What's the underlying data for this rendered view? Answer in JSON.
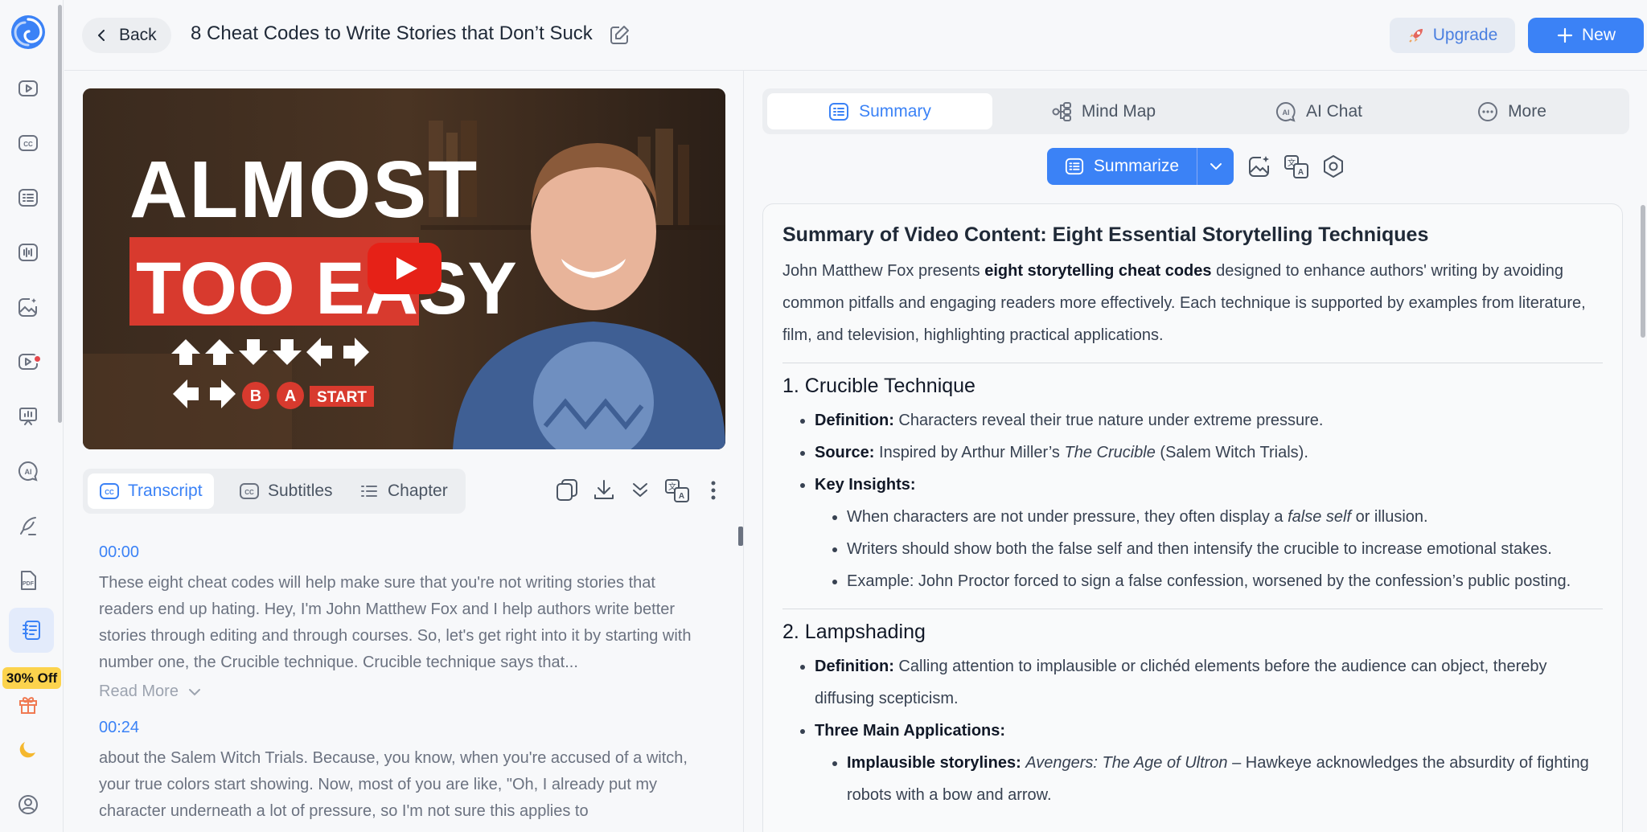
{
  "header": {
    "back_label": "Back",
    "title": "8 Cheat Codes to Write Stories that Don’t Suck",
    "upgrade_label": "Upgrade",
    "new_label": "New"
  },
  "sidebar": {
    "promo_badge": "30% Off",
    "items": [
      {
        "icon": "video-icon"
      },
      {
        "icon": "captions-icon"
      },
      {
        "icon": "list-icon"
      },
      {
        "icon": "audio-icon"
      },
      {
        "icon": "image-edit-icon"
      },
      {
        "icon": "video-ai-icon"
      },
      {
        "icon": "presentation-icon"
      },
      {
        "icon": "ai-chat-icon"
      },
      {
        "icon": "write-icon"
      },
      {
        "icon": "pdf-icon"
      },
      {
        "icon": "notes-icon"
      },
      {
        "icon": "gift-icon"
      },
      {
        "icon": "moon-icon"
      },
      {
        "icon": "account-icon"
      }
    ]
  },
  "video": {
    "thumb_line1": "ALMOST",
    "thumb_line2": "TOO EASY",
    "thumb_start": "START",
    "thumb_b": "B",
    "thumb_a": "A"
  },
  "left_tabs": {
    "transcript": "Transcript",
    "subtitles": "Subtitles",
    "chapter": "Chapter"
  },
  "transcript": [
    {
      "time": "00:00",
      "text": "These eight cheat codes will help make sure that you're not writing stories that readers end up hating. Hey, I'm John Matthew Fox and I help authors write better stories through editing and through courses. So, let's get right into it by starting with number one, the Crucible technique. Crucible technique says that...",
      "read_more": "Read More"
    },
    {
      "time": "00:24",
      "text": "about the Salem Witch Trials. Because, you know, when you're accused of a witch, your true colors start showing. Now, most of you are like, \"Oh, I already put my character underneath a lot of pressure, so I'm not sure this applies to"
    }
  ],
  "right_tabs": {
    "summary": "Summary",
    "mindmap": "Mind Map",
    "aichat": "AI Chat",
    "more": "More"
  },
  "summarize_label": "Summarize",
  "summary": {
    "title": "Summary of Video Content: Eight Essential Storytelling Techniques",
    "intro_pre": "John Matthew Fox presents ",
    "intro_bold": "eight storytelling cheat codes",
    "intro_post": " designed to enhance authors' writing by avoiding common pitfalls and engaging readers more effectively. Each technique is supported by examples from literature, film, and television, highlighting practical applications.",
    "s1_heading": "1. Crucible Technique",
    "s1_def_label": "Definition:",
    "s1_def_text": " Characters reveal their true nature under extreme pressure.",
    "s1_src_label": "Source:",
    "s1_src_pre": " Inspired by Arthur Miller’s ",
    "s1_src_italic": "The Crucible",
    "s1_src_post": " (Salem Witch Trials).",
    "s1_key_label": "Key Insights:",
    "s1_k1_pre": "When characters are not under pressure, they often display a ",
    "s1_k1_italic": "false self",
    "s1_k1_post": " or illusion.",
    "s1_k2": "Writers should show both the false self and then intensify the crucible to increase emotional stakes.",
    "s1_k3": "Example: John Proctor forced to sign a false confession, worsened by the confession’s public posting.",
    "s2_heading": "2. Lampshading",
    "s2_def_label": "Definition:",
    "s2_def_text": " Calling attention to implausible or clichéd elements before the audience can object, thereby diffusing scepticism.",
    "s2_apps_label": "Three Main Applications:",
    "s2_a1_label": "Implausible storylines:",
    "s2_a1_italic": "Avengers: The Age of Ultron",
    "s2_a1_text": " – Hawkeye acknowledges the absurdity of fighting robots with a bow and arrow."
  },
  "colors": {
    "accent": "#3b82f6",
    "badge": "#fcd34d",
    "youtube_red": "#e62117"
  }
}
